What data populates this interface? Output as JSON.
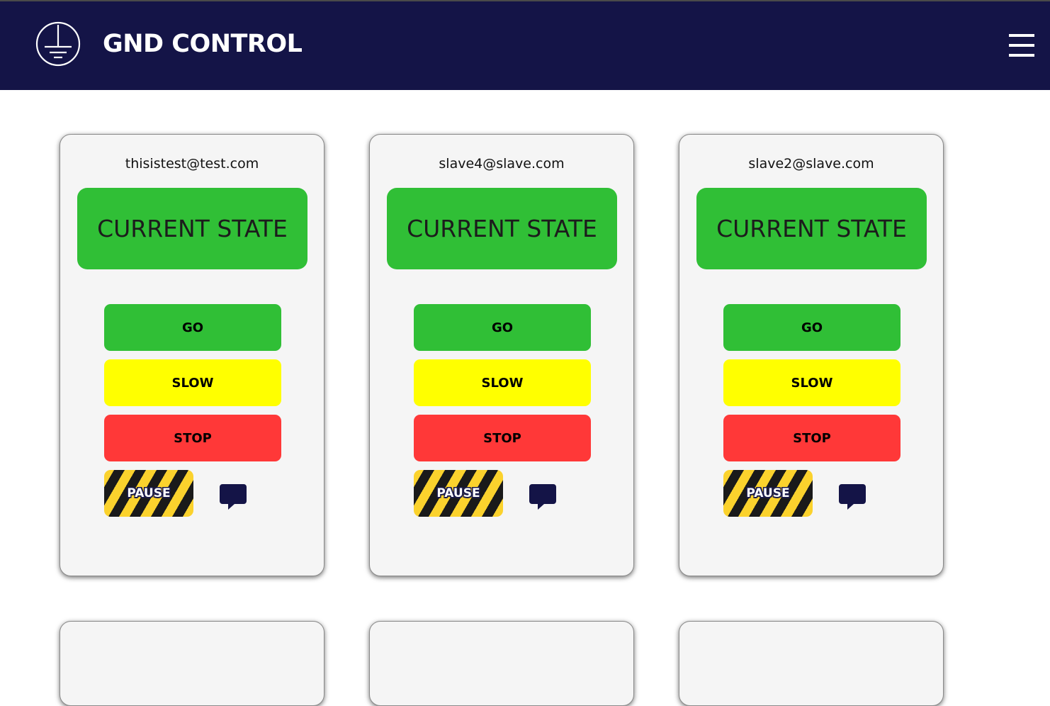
{
  "header": {
    "title": "GND CONTROL",
    "logo_icon": "ground-symbol-icon",
    "menu_icon": "hamburger-menu-icon",
    "background": "#141447"
  },
  "cards": [
    {
      "email": "thisistest@test.com",
      "state_label": "CURRENT STATE",
      "go_label": "GO",
      "slow_label": "SLOW",
      "stop_label": "STOP",
      "pause_label": "PAUSE",
      "chat_icon": "chat-bubble-icon"
    },
    {
      "email": "slave4@slave.com",
      "state_label": "CURRENT STATE",
      "go_label": "GO",
      "slow_label": "SLOW",
      "stop_label": "STOP",
      "pause_label": "PAUSE",
      "chat_icon": "chat-bubble-icon"
    },
    {
      "email": "slave2@slave.com",
      "state_label": "CURRENT STATE",
      "go_label": "GO",
      "slow_label": "SLOW",
      "stop_label": "STOP",
      "pause_label": "PAUSE",
      "chat_icon": "chat-bubble-icon"
    }
  ],
  "colors": {
    "state_green": "#30bf36",
    "go_green": "#30bf36",
    "slow_yellow": "#ffff00",
    "stop_red": "#ff3838",
    "pause_stripe_yellow": "#fbd22d",
    "pause_stripe_black": "#1a1a1a",
    "chat_icon": "#141447"
  }
}
